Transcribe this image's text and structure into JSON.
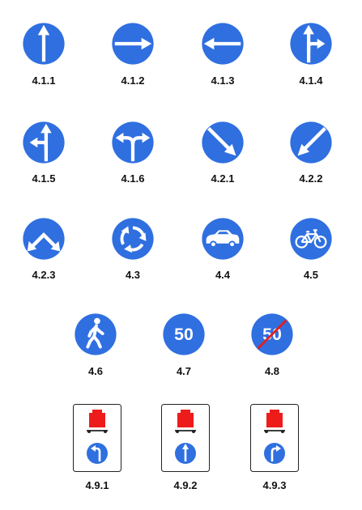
{
  "colors": {
    "sign_blue": "#2f6fe0",
    "sign_white": "#ffffff",
    "cancel_red": "#e0201e",
    "cargo_red": "#ee1b1b",
    "label_black": "#111111"
  },
  "signs": [
    {
      "code": "4.1.1",
      "icon": "arrow-straight-icon"
    },
    {
      "code": "4.1.2",
      "icon": "arrow-right-icon"
    },
    {
      "code": "4.1.3",
      "icon": "arrow-left-icon"
    },
    {
      "code": "4.1.4",
      "icon": "arrow-straight-or-right-icon"
    },
    {
      "code": "4.1.5",
      "icon": "arrow-straight-or-left-icon"
    },
    {
      "code": "4.1.6",
      "icon": "arrow-left-or-right-icon"
    },
    {
      "code": "4.2.1",
      "icon": "arrow-diagonal-down-right-icon"
    },
    {
      "code": "4.2.2",
      "icon": "arrow-diagonal-down-left-icon"
    },
    {
      "code": "4.2.3",
      "icon": "arrow-pass-both-sides-icon"
    },
    {
      "code": "4.3",
      "icon": "roundabout-icon"
    },
    {
      "code": "4.4",
      "icon": "car-icon"
    },
    {
      "code": "4.5",
      "icon": "bicycle-icon"
    },
    {
      "code": "4.6",
      "icon": "pedestrian-icon"
    },
    {
      "code": "4.7",
      "icon": "minimum-speed-icon",
      "text": "50"
    },
    {
      "code": "4.8",
      "icon": "minimum-speed-end-icon",
      "text": "50"
    },
    {
      "code": "4.9.1",
      "icon": "dangerous-goods-left-icon"
    },
    {
      "code": "4.9.2",
      "icon": "dangerous-goods-straight-icon"
    },
    {
      "code": "4.9.3",
      "icon": "dangerous-goods-right-icon"
    }
  ]
}
